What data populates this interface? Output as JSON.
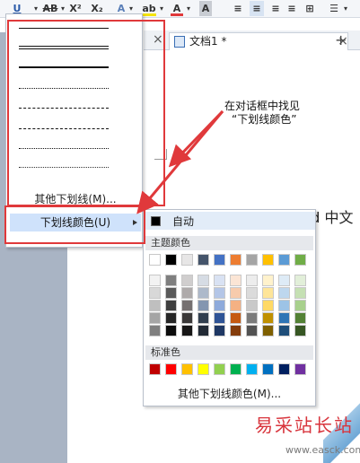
{
  "ribbon": {
    "underline": "U",
    "strike": "AB",
    "superscript": "X²",
    "subscript": "X₂",
    "font_effects": "A",
    "highlight": "ab",
    "font_color": "A",
    "char_shading": "A"
  },
  "tabs": {
    "doc_title": "文档1 *",
    "close": "×",
    "left_close": "×",
    "new_tab": "+"
  },
  "underline_menu": {
    "more_underline": "其他下划线(M)...",
    "underline_color": "下划线颜色(U)"
  },
  "color_panel": {
    "auto_label": "自动",
    "theme_label": "主题颜色",
    "standard_label": "标准色",
    "more_colors": "其他下划线颜色(M)...",
    "theme_row": [
      "#ffffff",
      "#000000",
      "#e7e6e6",
      "#44546a",
      "#4472c4",
      "#ed7d31",
      "#a5a5a5",
      "#ffc000",
      "#5b9bd5",
      "#70ad47"
    ],
    "theme_shades": [
      [
        "#f2f2f2",
        "#7f7f7f",
        "#d0cece",
        "#d6dce4",
        "#d9e2f3",
        "#fbe5d5",
        "#ededed",
        "#fff2cc",
        "#deebf6",
        "#e2efd9"
      ],
      [
        "#d8d8d8",
        "#595959",
        "#aeaaaa",
        "#adb9ca",
        "#b4c6e7",
        "#f7cbac",
        "#dbdbdb",
        "#fee599",
        "#bdd7ee",
        "#c5e0b3"
      ],
      [
        "#bfbfbf",
        "#3f3f3f",
        "#757070",
        "#8496b0",
        "#8eaadb",
        "#f4b183",
        "#c9c9c9",
        "#ffd965",
        "#9dc3e6",
        "#a8d08d"
      ],
      [
        "#a5a5a5",
        "#262626",
        "#3a3838",
        "#323f4f",
        "#2f5496",
        "#c55a11",
        "#7b7b7b",
        "#bf9000",
        "#2e75b5",
        "#538135"
      ],
      [
        "#7f7f7f",
        "#0c0c0c",
        "#171616",
        "#222a35",
        "#1f3864",
        "#843c0b",
        "#525252",
        "#7f6000",
        "#1e4e79",
        "#375623"
      ]
    ],
    "standard_colors": [
      "#c00000",
      "#ff0000",
      "#ffc000",
      "#ffff00",
      "#92d050",
      "#00b050",
      "#00b0f0",
      "#0070c0",
      "#002060",
      "#7030a0"
    ]
  },
  "annotation": {
    "line1": "在对话框中找见",
    "line2": "“下划线颜色”"
  },
  "doc_text": "新版 word 中文",
  "watermark": {
    "title": "易采站长站",
    "url": "www.easck.com"
  },
  "accent": "#e0393b"
}
